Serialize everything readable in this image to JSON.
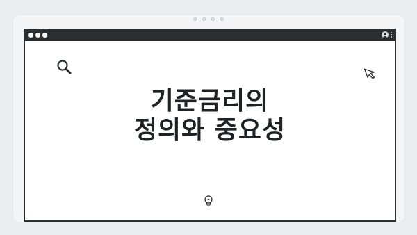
{
  "title": {
    "line1": "기준금리의",
    "line2": "정의와 중요성"
  },
  "icons": {
    "search": "search-icon",
    "cursor": "cursor-arrow-icon",
    "bulb": "lightbulb-icon",
    "user": "user-icon",
    "menu": "kebab-menu-icon"
  },
  "colors": {
    "titlebar": "#2b2e31",
    "background": "#e9edf0",
    "content": "#ffffff",
    "text": "#1f2225"
  }
}
